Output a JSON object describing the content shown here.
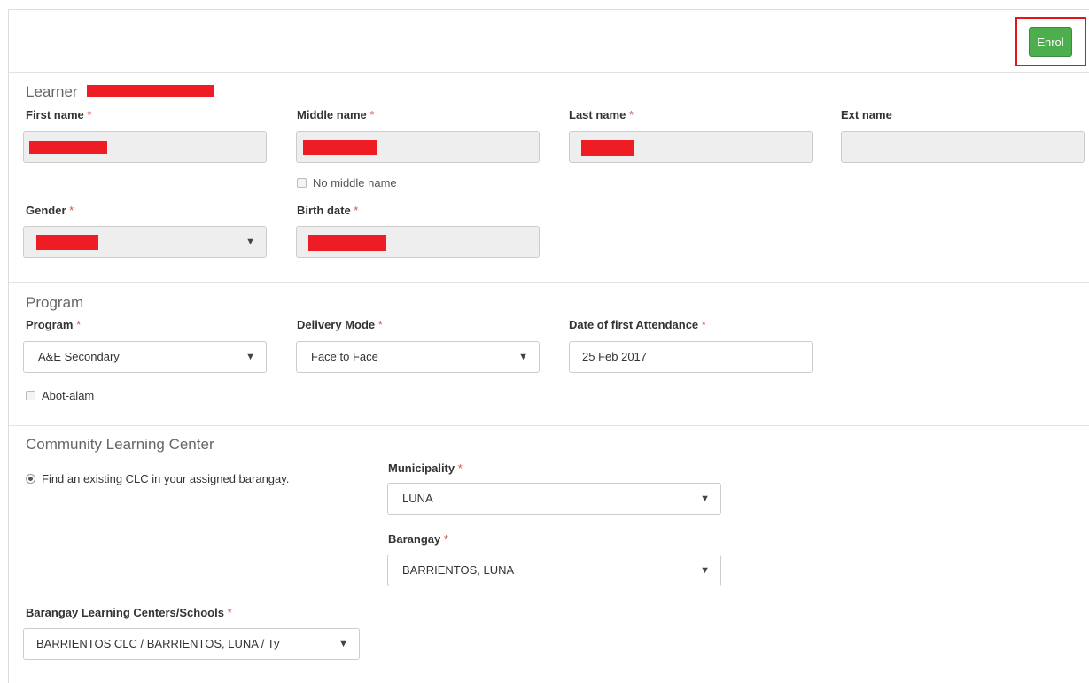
{
  "header": {
    "enrol_label": "Enrol"
  },
  "learner": {
    "section_title": "Learner",
    "first_name_label": "First name",
    "middle_name_label": "Middle name",
    "last_name_label": "Last name",
    "ext_name_label": "Ext name",
    "ext_name_value": "",
    "no_middle_name_label": "No middle name",
    "gender_label": "Gender",
    "birth_date_label": "Birth date",
    "required_mark": "*"
  },
  "program": {
    "section_title": "Program",
    "program_label": "Program",
    "program_value": "A&E Secondary",
    "delivery_mode_label": "Delivery Mode",
    "delivery_mode_value": "Face to Face",
    "first_attendance_label": "Date of first Attendance",
    "first_attendance_value": "25 Feb 2017",
    "abot_alam_label": "Abot-alam"
  },
  "clc": {
    "section_title": "Community Learning Center",
    "find_existing_label": "Find an existing CLC in your assigned barangay.",
    "municipality_label": "Municipality",
    "municipality_value": "LUNA",
    "barangay_label": "Barangay",
    "barangay_value": "BARRIENTOS, LUNA",
    "centers_label": "Barangay Learning Centers/Schools",
    "centers_value": "BARRIENTOS CLC / BARRIENTOS, LUNA / Ty"
  },
  "icons": {
    "caret": "▼"
  },
  "colors": {
    "enrol_green": "#4cae4c",
    "highlight_red": "#e3151a",
    "redaction_red": "#ee1c24"
  }
}
